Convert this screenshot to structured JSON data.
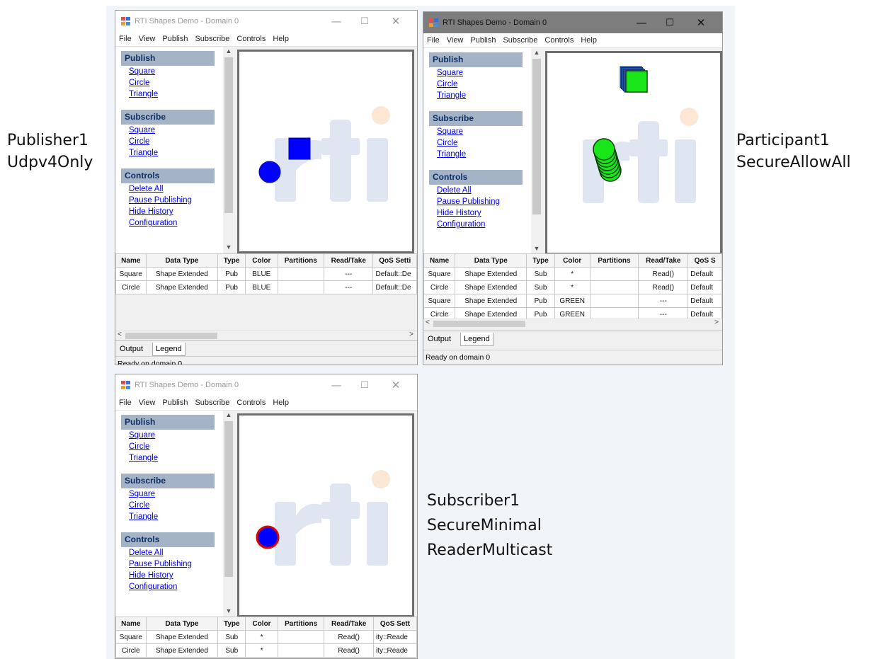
{
  "app_title": "RTI Shapes Demo - Domain 0",
  "menu": [
    "File",
    "View",
    "Publish",
    "Subscribe",
    "Controls",
    "Help"
  ],
  "nav": {
    "publish": {
      "header": "Publish",
      "items": [
        "Square",
        "Circle",
        "Triangle"
      ]
    },
    "subscribe": {
      "header": "Subscribe",
      "items": [
        "Square",
        "Circle",
        "Triangle"
      ]
    },
    "controls": {
      "header": "Controls",
      "items": [
        "Delete All",
        "Pause Publishing",
        "Hide History",
        "Configuration"
      ]
    }
  },
  "columns": [
    "Name",
    "Data Type",
    "Type",
    "Color",
    "Partitions",
    "Read/Take"
  ],
  "windows": [
    {
      "qos_header": "QoS Setti",
      "rows": [
        [
          "Square",
          "Shape Extended",
          "Pub",
          "BLUE",
          "",
          "---",
          "Default::De"
        ],
        [
          "Circle",
          "Shape Extended",
          "Pub",
          "BLUE",
          "",
          "---",
          "Default::De"
        ]
      ]
    },
    {
      "qos_header": "QoS S",
      "rows": [
        [
          "Square",
          "Shape Extended",
          "Sub",
          "*",
          "",
          "Read()",
          "Default"
        ],
        [
          "Circle",
          "Shape Extended",
          "Sub",
          "*",
          "",
          "Read()",
          "Default"
        ],
        [
          "Square",
          "Shape Extended",
          "Pub",
          "GREEN",
          "",
          "---",
          "Default"
        ],
        [
          "Circle",
          "Shape Extended",
          "Pub",
          "GREEN",
          "",
          "---",
          "Default"
        ]
      ]
    },
    {
      "qos_header": "QoS Sett",
      "rows": [
        [
          "Square",
          "Shape Extended",
          "Sub",
          "*",
          "",
          "Read()",
          "ity::Reade"
        ],
        [
          "Circle",
          "Shape Extended",
          "Sub",
          "*",
          "",
          "Read()",
          "ity::Reade"
        ]
      ]
    }
  ],
  "tabs": {
    "output": "Output",
    "legend": "Legend"
  },
  "status_text": "Ready on domain 0",
  "captions": {
    "publisher": [
      "Publisher1",
      "Udpv4Only"
    ],
    "participant": [
      "Participant1",
      "SecureAllowAll"
    ],
    "subscriber": [
      "Subscriber1",
      "SecureMinimal",
      "ReaderMulticast"
    ]
  },
  "colors": {
    "blue": "#0000ff",
    "green": "#19e619",
    "outline_red": "#e00000",
    "nav_header": "#a5b3c6"
  },
  "icons": [
    "app-icon",
    "minimize-icon",
    "maximize-icon",
    "close-icon",
    "scroll-up-icon",
    "scroll-down-icon",
    "scroll-left-icon",
    "scroll-right-icon"
  ]
}
